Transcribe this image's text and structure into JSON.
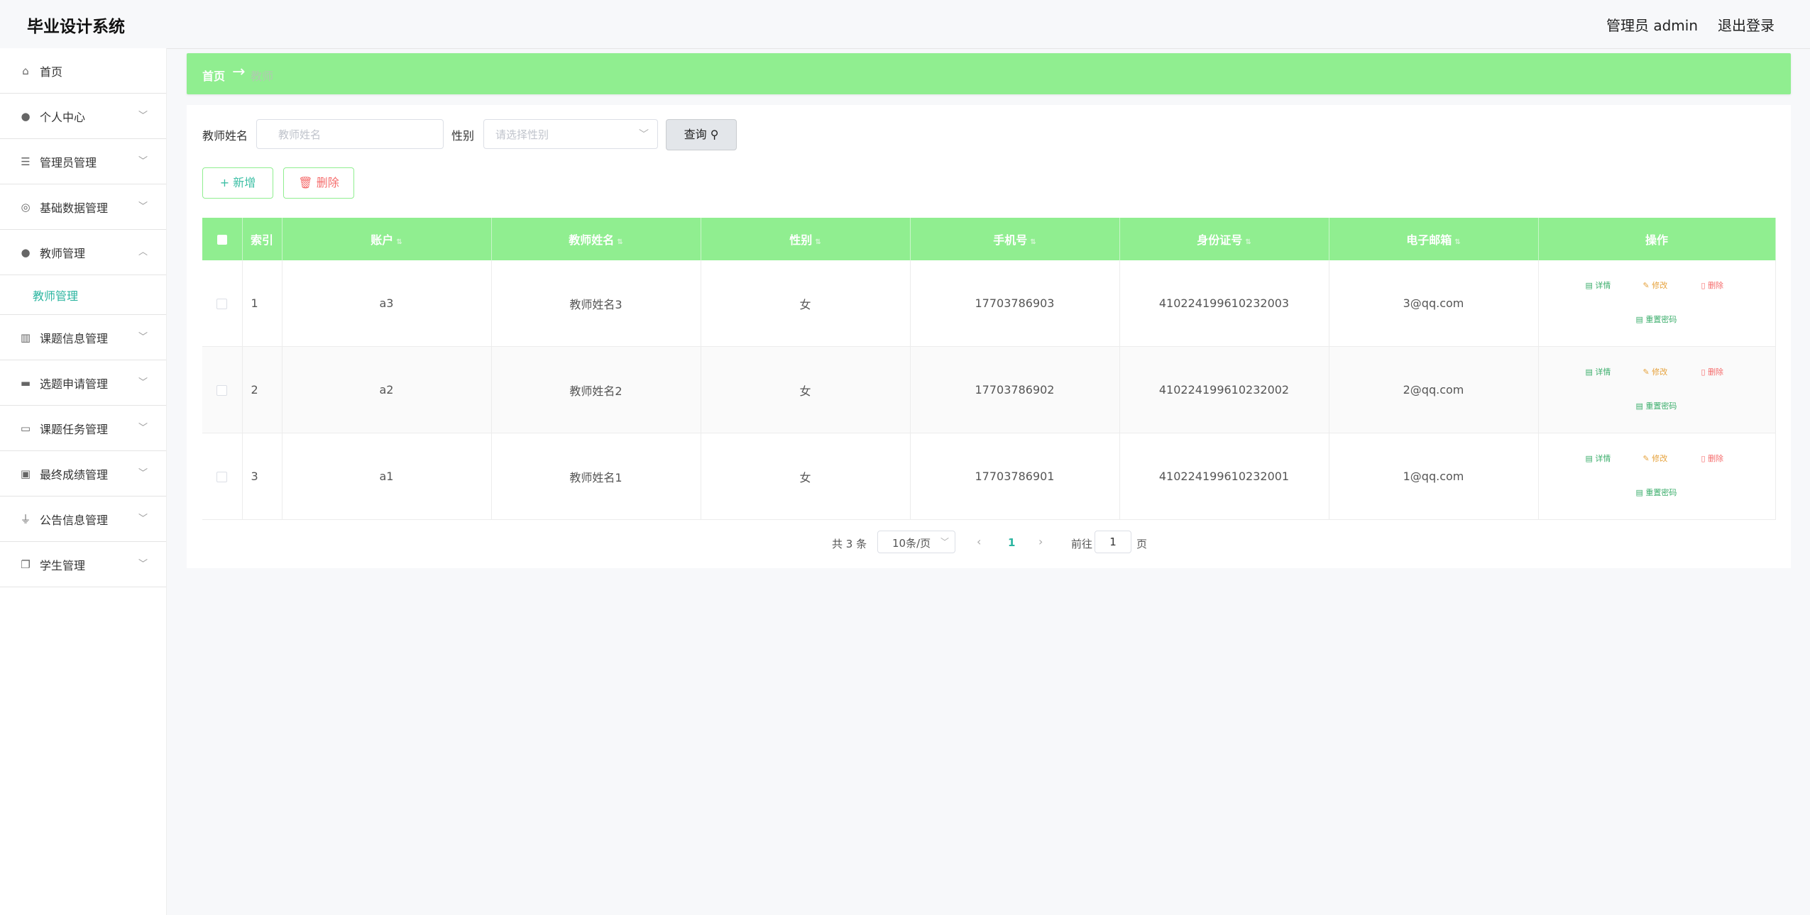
{
  "app": {
    "title": "毕业设计系统"
  },
  "header": {
    "user": "管理员 admin",
    "logout": "退出登录"
  },
  "sidebar": {
    "items": [
      {
        "label": "首页",
        "icon": "home-icon"
      },
      {
        "label": "个人中心",
        "icon": "user-icon"
      },
      {
        "label": "管理员管理",
        "icon": "list-icon"
      },
      {
        "label": "基础数据管理",
        "icon": "compass-icon"
      },
      {
        "label": "教师管理",
        "icon": "user-icon",
        "expanded": true
      },
      {
        "label": "课题信息管理",
        "icon": "books-icon"
      },
      {
        "label": "选题申请管理",
        "icon": "stamp-icon"
      },
      {
        "label": "课题任务管理",
        "icon": "monitor-icon"
      },
      {
        "label": "最终成绩管理",
        "icon": "scorecard-icon"
      },
      {
        "label": "公告信息管理",
        "icon": "microphone-icon"
      },
      {
        "label": "学生管理",
        "icon": "copy-icon"
      }
    ],
    "submenu": {
      "label": "教师管理"
    }
  },
  "breadcrumb": {
    "home": "首页",
    "arrow": "→",
    "current": "教师"
  },
  "search": {
    "name_label": "教师姓名",
    "name_placeholder": "教师姓名",
    "gender_label": "性别",
    "gender_placeholder": "请选择性别",
    "query_button": "查询"
  },
  "actions": {
    "add": "新增",
    "delete": "删除"
  },
  "table": {
    "headers": {
      "index": "索引",
      "account": "账户",
      "name": "教师姓名",
      "gender": "性别",
      "phone": "手机号",
      "id_card": "身份证号",
      "email": "电子邮箱",
      "ops": "操作"
    },
    "op_labels": {
      "detail": "详情",
      "edit": "修改",
      "remove": "删除",
      "reset": "重置密码"
    },
    "rows": [
      {
        "index": "1",
        "account": "a3",
        "name": "教师姓名3",
        "gender": "女",
        "phone": "17703786903",
        "id_card": "410224199610232003",
        "email": "3@qq.com"
      },
      {
        "index": "2",
        "account": "a2",
        "name": "教师姓名2",
        "gender": "女",
        "phone": "17703786902",
        "id_card": "410224199610232002",
        "email": "2@qq.com"
      },
      {
        "index": "3",
        "account": "a1",
        "name": "教师姓名1",
        "gender": "女",
        "phone": "17703786901",
        "id_card": "410224199610232001",
        "email": "1@qq.com"
      }
    ]
  },
  "pagination": {
    "total": "共 3 条",
    "page_size": "10条/页",
    "current_page": "1",
    "goto_label": "前往",
    "goto_value": "1",
    "goto_suffix": "页"
  },
  "colors": {
    "accent_green": "#90ee90",
    "link_teal": "#2bb5a0",
    "danger": "#f56c6c",
    "warning": "#e6a23c"
  }
}
